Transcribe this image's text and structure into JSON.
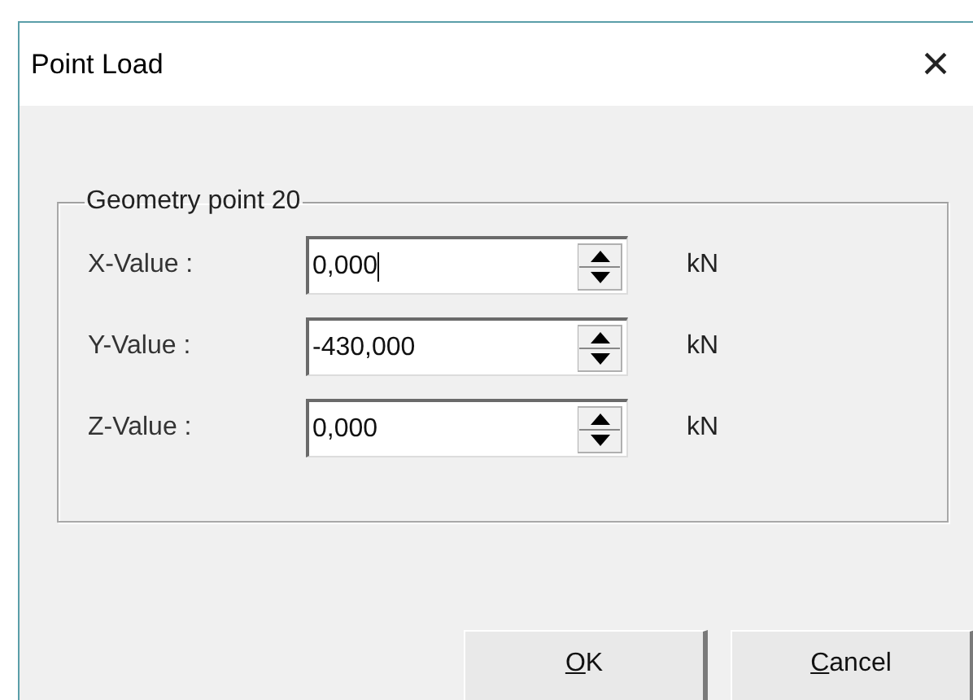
{
  "window": {
    "title": "Point Load",
    "close": "×"
  },
  "group": {
    "title": "Geometry point 20",
    "fields": [
      {
        "label": "X-Value :",
        "value": "0,000",
        "unit": "kN",
        "focused": true
      },
      {
        "label": "Y-Value :",
        "value": "-430,000",
        "unit": "kN",
        "focused": false
      },
      {
        "label": "Z-Value :",
        "value": "0,000",
        "unit": "kN",
        "focused": false
      }
    ]
  },
  "buttons": [
    {
      "mnemonic": "O",
      "rest": "K"
    },
    {
      "mnemonic": "C",
      "rest": "ancel"
    }
  ]
}
